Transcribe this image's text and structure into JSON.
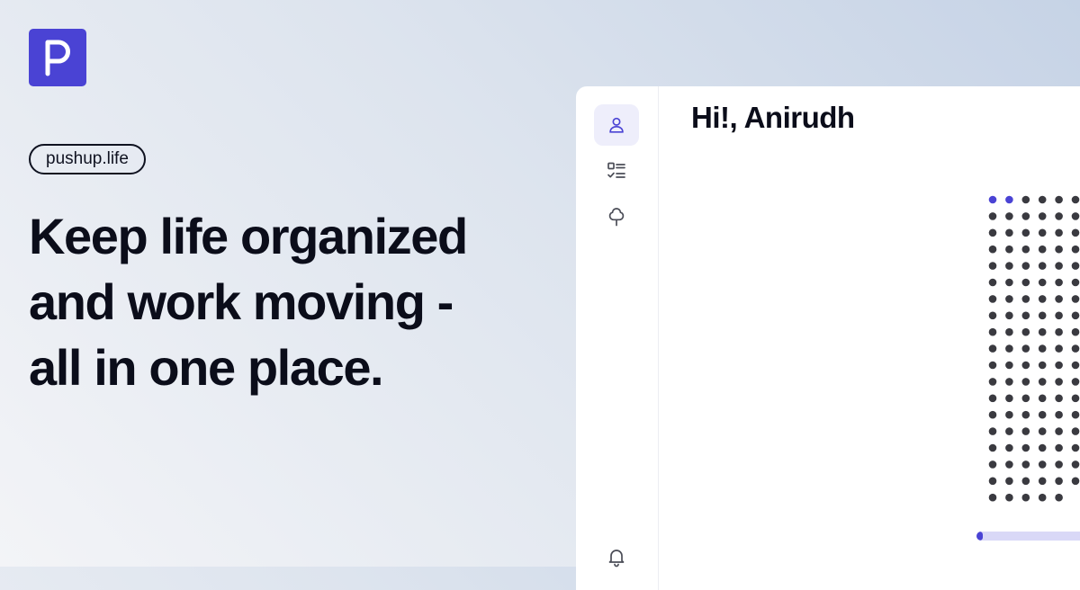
{
  "brand": {
    "logo_letter": "P",
    "logo_color": "#4a43d4",
    "domain_label": "pushup.life"
  },
  "hero": {
    "lines": [
      "Keep life organized",
      "and work moving -",
      "all in one place."
    ]
  },
  "app": {
    "greeting": "Hi!, Anirudh",
    "rail_icons": [
      "user-icon",
      "checklist-icon",
      "tree-icon",
      "bell-icon"
    ],
    "active_rail_item": "user-icon",
    "dot_grid": {
      "rows": 19,
      "visible_columns": 6,
      "highlighted_count": 2,
      "last_row_dots": 5,
      "highlight_color": "#4a43d4",
      "dot_color": "#3a3a40"
    },
    "progress": {
      "value": 0.05,
      "fill_color": "#4a43d4",
      "track_color": "#d9d8f7"
    }
  }
}
